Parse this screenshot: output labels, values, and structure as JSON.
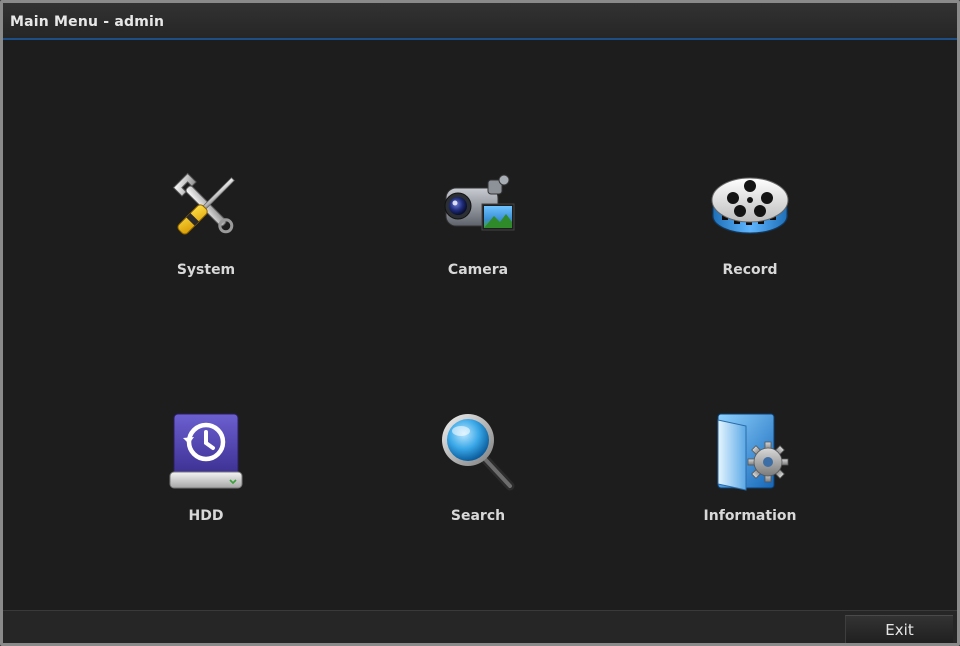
{
  "window": {
    "title": "Main Menu - admin"
  },
  "menu": {
    "items": [
      {
        "label": "System",
        "icon": "tools-icon"
      },
      {
        "label": "Camera",
        "icon": "camera-icon"
      },
      {
        "label": "Record",
        "icon": "film-reel-icon"
      },
      {
        "label": "HDD",
        "icon": "hdd-icon"
      },
      {
        "label": "Search",
        "icon": "magnifier-icon"
      },
      {
        "label": "Information",
        "icon": "info-folder-icon"
      }
    ]
  },
  "footer": {
    "exit_label": "Exit"
  },
  "colors": {
    "background": "#1d1d1d",
    "titlebar_accent": "#1d4f86",
    "text": "#d8d8d8"
  }
}
